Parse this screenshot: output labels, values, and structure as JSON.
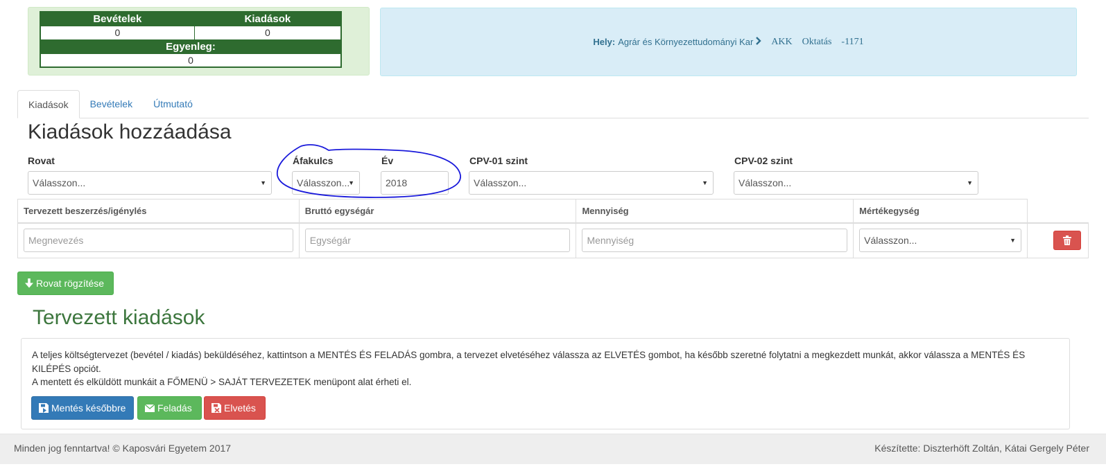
{
  "summary": {
    "income_label": "Bevételek",
    "expense_label": "Kiadások",
    "income_value": "0",
    "expense_value": "0",
    "balance_label": "Egyenleg:",
    "balance_value": "0"
  },
  "location": {
    "label": "Hely:",
    "faculty": "Agrár és Környezettudományi Kar",
    "crumbs": [
      "AKK",
      "Oktatás",
      "-1171"
    ]
  },
  "tabs": [
    {
      "label": "Kiadások",
      "active": true
    },
    {
      "label": "Bevételek",
      "active": false
    },
    {
      "label": "Útmutató",
      "active": false
    }
  ],
  "form": {
    "title": "Kiadások hozzáadása",
    "rovat": {
      "label": "Rovat",
      "value": "Válasszon..."
    },
    "afakulcs": {
      "label": "Áfakulcs",
      "value": "Válasszon..."
    },
    "ev": {
      "label": "Év",
      "value": "2018"
    },
    "cpv01": {
      "label": "CPV-01 szint",
      "value": "Válasszon..."
    },
    "cpv02": {
      "label": "CPV-02 szint",
      "value": "Válasszon..."
    }
  },
  "item_table": {
    "headers": [
      "Tervezett beszerzés/igénylés",
      "Bruttó egységár",
      "Mennyiség",
      "Mértékegység"
    ],
    "row": {
      "name_placeholder": "Megnevezés",
      "price_placeholder": "Egységár",
      "qty_placeholder": "Mennyiség",
      "unit_value": "Válasszon..."
    }
  },
  "save_row_button": "Rovat rögzítése",
  "planned": {
    "title": "Tervezett kiadások",
    "text1": "A teljes költségtervezet (bevétel / kiadás) beküldéséhez, kattintson a MENTÉS ÉS FELADÁS gombra, a tervezet elvetéséhez válassza az ELVETÉS gombot, ha később szeretné folytatni a megkezdett munkát, akkor válassza a MENTÉS ÉS KILÉPÉS opciót.",
    "text2": "A mentett és elküldött munkáit a FŐMENÜ > SAJÁT TERVEZETEK menüpont alat érheti el.",
    "save_later": "Mentés későbbre",
    "submit": "Feladás",
    "discard": "Elvetés"
  },
  "footer": {
    "left": "Minden jog fenntartva! © Kaposvári Egyetem 2017",
    "right": "Készítette: Diszterhöft Zoltán, Kátai Gergely Péter"
  },
  "colors": {
    "success": "#5cb85c",
    "primary": "#337ab7",
    "danger": "#d9534f",
    "balance_header": "#2e6b2f",
    "annotation": "#1a1adb"
  },
  "icons": [
    "chevron-right-icon",
    "trash-icon",
    "download-arrow-icon",
    "save-icon",
    "envelope-icon",
    "discard-icon"
  ]
}
